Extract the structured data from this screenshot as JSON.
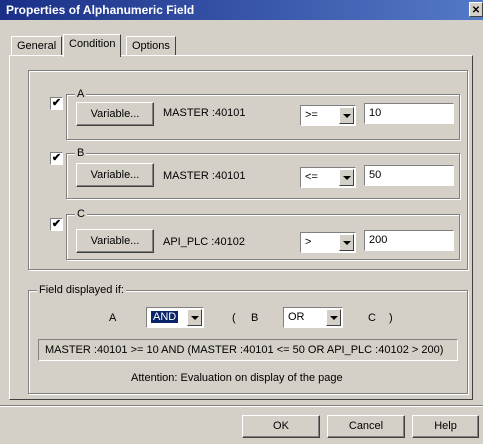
{
  "window": {
    "title": "Properties of Alphanumeric Field",
    "close_glyph": "✕"
  },
  "tabs": [
    {
      "label": "General",
      "active": false
    },
    {
      "label": "Condition",
      "active": true
    },
    {
      "label": "Options",
      "active": false
    }
  ],
  "conditions": [
    {
      "name": "A",
      "checked": true,
      "checkmark": "✔",
      "button_label": "Variable...",
      "variable": "MASTER :40101",
      "operator": ">=",
      "value": "10"
    },
    {
      "name": "B",
      "checked": true,
      "checkmark": "✔",
      "button_label": "Variable...",
      "variable": "MASTER :40101",
      "operator": "<=",
      "value": "50"
    },
    {
      "name": "C",
      "checked": true,
      "checkmark": "✔",
      "button_label": "Variable...",
      "variable": "API_PLC :40102",
      "operator": ">",
      "value": "200"
    }
  ],
  "field_displayed": {
    "group_label": "Field displayed if:",
    "term_a": "A",
    "op1": "AND",
    "open_paren": "(",
    "term_b": "B",
    "op2": "OR",
    "term_c": "C",
    "close_paren": ")",
    "expression": "MASTER :40101  >= 10 AND (MASTER :40101  <= 50 OR API_PLC :40102  > 200)",
    "attention": "Attention: Evaluation on display of the page"
  },
  "footer": {
    "ok": "OK",
    "cancel": "Cancel",
    "help": "Help"
  },
  "colors": {
    "titlebar_start": "#1a2f87",
    "titlebar_end": "#5479c8",
    "face": "#d4d0c8",
    "highlight": "#0a246a"
  }
}
